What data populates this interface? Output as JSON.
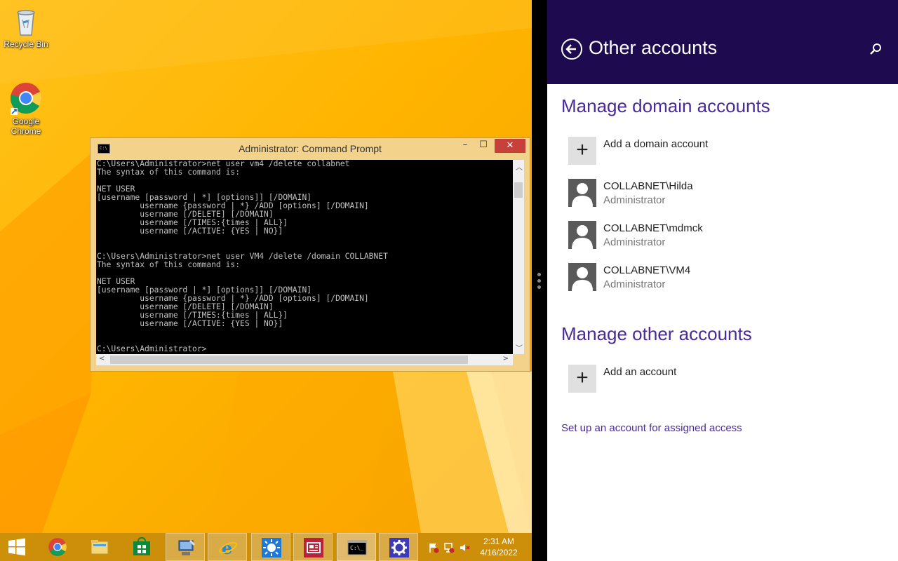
{
  "desktop": {
    "icons": [
      {
        "label": "Recycle Bin",
        "icon": "recycle-bin-icon"
      },
      {
        "label": "Google Chrome",
        "icon": "chrome-icon"
      }
    ]
  },
  "cmd": {
    "title": "Administrator: Command Prompt",
    "minimize_label": "–",
    "maximize_label": "☐",
    "close_label": "✕",
    "lines": [
      "C:\\Users\\Administrator>net user vm4 /delete collabnet",
      "The syntax of this command is:",
      "",
      "NET USER",
      "[username [password | *] [options]] [/DOMAIN]",
      "         username {password | *} /ADD [options] [/DOMAIN]",
      "         username [/DELETE] [/DOMAIN]",
      "         username [/TIMES:{times | ALL}]",
      "         username [/ACTIVE: {YES | NO}]",
      "",
      "",
      "C:\\Users\\Administrator>net user VM4 /delete /domain COLLABNET",
      "The syntax of this command is:",
      "",
      "NET USER",
      "[username [password | *] [options]] [/DOMAIN]",
      "         username {password | *} /ADD [options] [/DOMAIN]",
      "         username [/DELETE] [/DOMAIN]",
      "         username [/TIMES:{times | ALL}]",
      "         username [/ACTIVE: {YES | NO}]",
      "",
      "",
      "C:\\Users\\Administrator>"
    ]
  },
  "taskbar": {
    "buttons": [
      {
        "name": "start-button",
        "icon": "windows-logo-icon"
      },
      {
        "name": "chrome-taskbar-button",
        "icon": "chrome-icon"
      },
      {
        "name": "file-explorer-button",
        "icon": "folder-icon"
      },
      {
        "name": "store-button",
        "icon": "store-icon"
      },
      {
        "name": "server-manager-button",
        "icon": "server-manager-icon"
      },
      {
        "name": "internet-explorer-button",
        "icon": "ie-icon"
      },
      {
        "name": "weather-button",
        "icon": "sun-icon"
      },
      {
        "name": "news-button",
        "icon": "news-icon"
      },
      {
        "name": "command-prompt-button",
        "icon": "cmd-icon"
      },
      {
        "name": "settings-button",
        "icon": "gear-icon"
      }
    ],
    "clock": {
      "time": "2:31 AM",
      "date": "4/16/2022"
    }
  },
  "panel": {
    "title": "Other accounts",
    "domain_section_title": "Manage domain accounts",
    "add_domain_account": "Add a domain account",
    "accounts": [
      {
        "name": "COLLABNET\\Hilda",
        "role": "Administrator"
      },
      {
        "name": "COLLABNET\\mdmck",
        "role": "Administrator"
      },
      {
        "name": "COLLABNET\\VM4",
        "role": "Administrator"
      }
    ],
    "other_section_title": "Manage other accounts",
    "add_account": "Add an account",
    "assigned_access_link": "Set up an account for assigned access"
  },
  "colors": {
    "panel_header": "#1d0a4f",
    "accent_purple": "#4a2a98",
    "desktop_orange": "#ffb400",
    "close_red": "#c7403a"
  }
}
